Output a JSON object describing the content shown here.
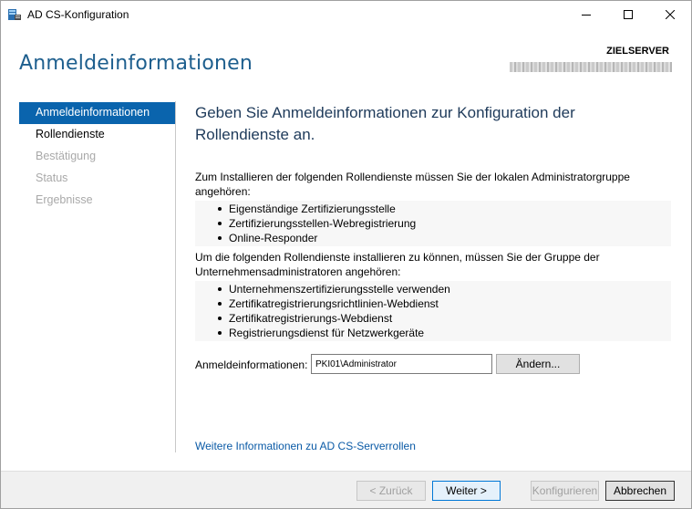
{
  "window": {
    "title": "AD CS-Konfiguration"
  },
  "header": {
    "page_title": "Anmeldeinformationen",
    "target_label": "ZIELSERVER"
  },
  "nav": {
    "items": [
      {
        "label": "Anmeldeinformationen",
        "state": "active"
      },
      {
        "label": "Rollendienste",
        "state": "enabled"
      },
      {
        "label": "Bestätigung",
        "state": "disabled"
      },
      {
        "label": "Status",
        "state": "disabled"
      },
      {
        "label": "Ergebnisse",
        "state": "disabled"
      }
    ]
  },
  "content": {
    "heading": "Geben Sie Anmeldeinformationen zur Konfiguration der Rollendienste an.",
    "local_admin_text": "Zum Installieren der folgenden Rollendienste müssen Sie der lokalen Administratorgruppe angehören:",
    "local_admin_roles": [
      "Eigenständige Zertifizierungsstelle",
      "Zertifizierungsstellen-Webregistrierung",
      "Online-Responder"
    ],
    "enterprise_admin_text": "Um die folgenden Rollendienste installieren zu können, müssen Sie der Gruppe der Unternehmensadministratoren angehören:",
    "enterprise_admin_roles": [
      "Unternehmenszertifizierungsstelle verwenden",
      "Zertifikatregistrierungsrichtlinien-Webdienst",
      "Zertifikatregistrierungs-Webdienst",
      "Registrierungsdienst für Netzwerkgeräte"
    ],
    "credentials_label": "Anmeldeinformationen:",
    "credentials_value": "PKI01\\Administrator",
    "change_button": "Ändern...",
    "more_info_link": "Weitere Informationen zu AD CS-Serverrollen"
  },
  "footer": {
    "back_button": "< Zurück",
    "next_button": "Weiter >",
    "configure_button": "Konfigurieren",
    "cancel_button": "Abbrechen"
  },
  "colors": {
    "accent": "#0a64ad",
    "title_blue": "#1e5f8e",
    "link": "#0a5aa6"
  },
  "icons": {
    "app": "server-manager-icon",
    "minimize": "minimize-icon",
    "maximize": "maximize-icon",
    "close": "close-icon"
  }
}
